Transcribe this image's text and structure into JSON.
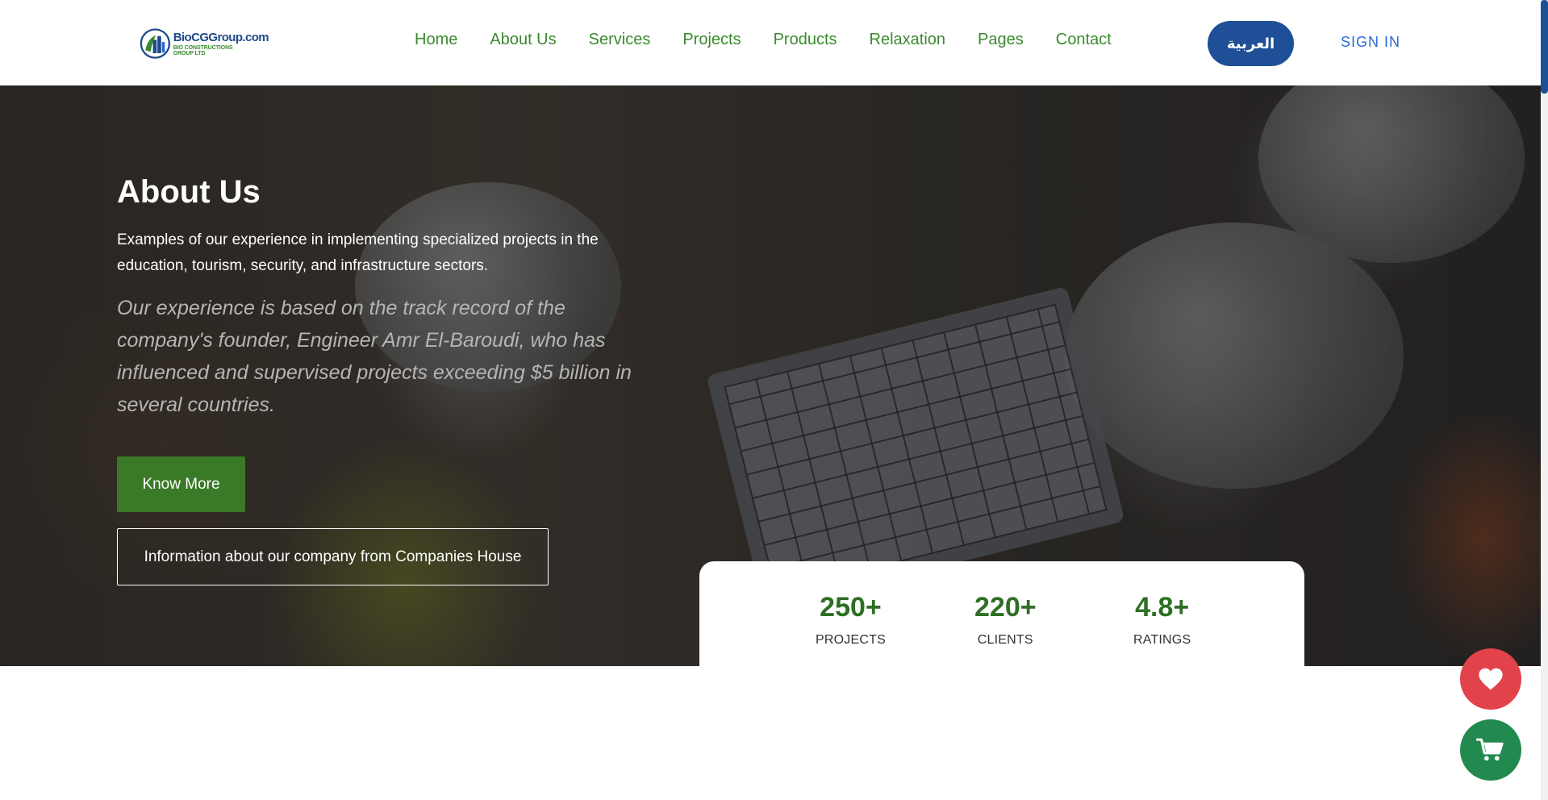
{
  "header": {
    "logo": {
      "name": "BioCGGroup.com",
      "sub_line1": "BIO CONSTRUCTIONS",
      "sub_line2": "GROUP LTD"
    },
    "nav": [
      {
        "label": "Home"
      },
      {
        "label": "About Us"
      },
      {
        "label": "Services"
      },
      {
        "label": "Projects"
      },
      {
        "label": "Products"
      },
      {
        "label": "Relaxation"
      },
      {
        "label": "Pages"
      },
      {
        "label": "Contact"
      }
    ],
    "language_button": "العربية",
    "sign_in": "SIGN IN"
  },
  "hero": {
    "title": "About Us",
    "lead": "Examples of our experience in implementing specialized projects in the education, tourism, security, and infrastructure sectors.",
    "quote": "Our experience is based on the track record of the company's founder, Engineer Amr El-Baroudi, who has influenced and supervised projects exceeding $5 billion in several countries.",
    "primary_button": "Know More",
    "secondary_button": "Information about our company from Companies House"
  },
  "stats": [
    {
      "value": "250+",
      "label": "PROJECTS"
    },
    {
      "value": "220+",
      "label": "CLIENTS"
    },
    {
      "value": "4.8+",
      "label": "RATINGS"
    }
  ],
  "floating_actions": {
    "wishlist_icon": "heart-icon",
    "cart_icon": "cart-icon"
  },
  "colors": {
    "brand_green": "#3a7a26",
    "nav_green": "#3a8a2e",
    "brand_blue": "#1f4f96",
    "signin_blue": "#2a6bd6",
    "heart_red": "#e2424a",
    "cart_green": "#238a4f"
  }
}
